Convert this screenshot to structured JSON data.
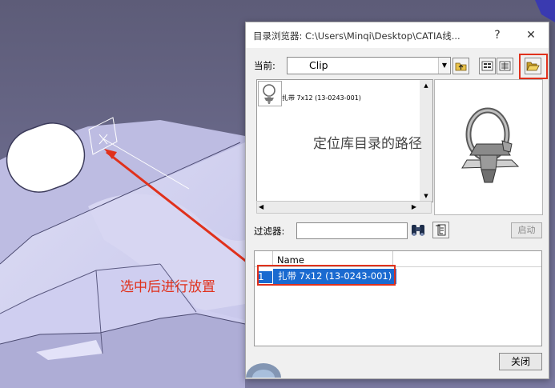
{
  "dialog": {
    "title": "目录浏览器: C:\\Users\\Minqi\\Desktop\\CATIA线...",
    "help_label": "?",
    "close_x": "✕",
    "current_label": "当前:",
    "current_value": "Clip",
    "list_item": "扎带 7x12 (13-0243-001)",
    "filter_label": "过滤器:",
    "filter_value": "",
    "start_button": "启动",
    "table_column": "Name",
    "row": {
      "index": "1",
      "name": "扎带 7x12 (13-0243-001)"
    },
    "close_button": "关闭"
  },
  "annotations": {
    "path_note": "定位库目录的路径",
    "place_note": "选中后进行放置",
    "color": "#e0311c"
  },
  "icons": [
    "folder-up-icon",
    "view-icons-icon",
    "view-details-icon",
    "open-folder-icon",
    "binoculars-icon",
    "filter-icon",
    "clip-thumbnail-icon",
    "clip-preview-icon"
  ]
}
